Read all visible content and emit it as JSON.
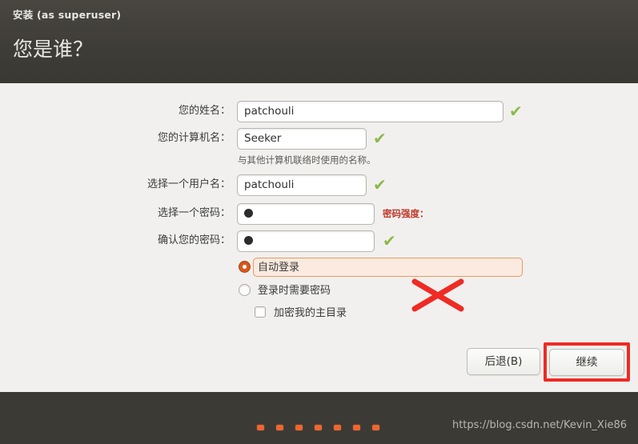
{
  "window": {
    "title": "安装 (as superuser)",
    "heading": "您是谁？"
  },
  "form": {
    "fields": [
      {
        "label": "您的姓名：",
        "value": "patchouli",
        "valid": "✔",
        "type": "text"
      },
      {
        "label": "您的计算机名：",
        "value": "Seeker",
        "valid": "✔",
        "type": "text"
      },
      {
        "label": "选择一个用户名：",
        "value": "patchouli",
        "valid": "✔",
        "type": "text"
      },
      {
        "label": "选择一个密码：",
        "value": "",
        "valid": "",
        "type": "password"
      },
      {
        "label": "确认您的密码：",
        "value": "",
        "valid": "✔",
        "type": "password"
      }
    ],
    "hostname_hint": "与其他计算机联络时使用的名称。",
    "password_strength_label": "密码强度："
  },
  "login_options": {
    "auto_login": {
      "label": "自动登录",
      "selected": true
    },
    "require_password": {
      "label": "登录时需要密码",
      "selected": false
    },
    "encrypt_home": {
      "label": "加密我的主目录",
      "checked": false
    }
  },
  "buttons": {
    "back": "后退(B)",
    "continue": "继续"
  },
  "footer": {
    "watermark": "https://blog.csdn.net/Kevin_Xie86",
    "progress_dots": 7
  },
  "colors": {
    "header_bg": "#3f3d37",
    "body_bg": "#f1f0ee",
    "accent_orange": "#f0652f",
    "valid_green": "#8cb84b",
    "annotation_red": "#ee2b24"
  }
}
